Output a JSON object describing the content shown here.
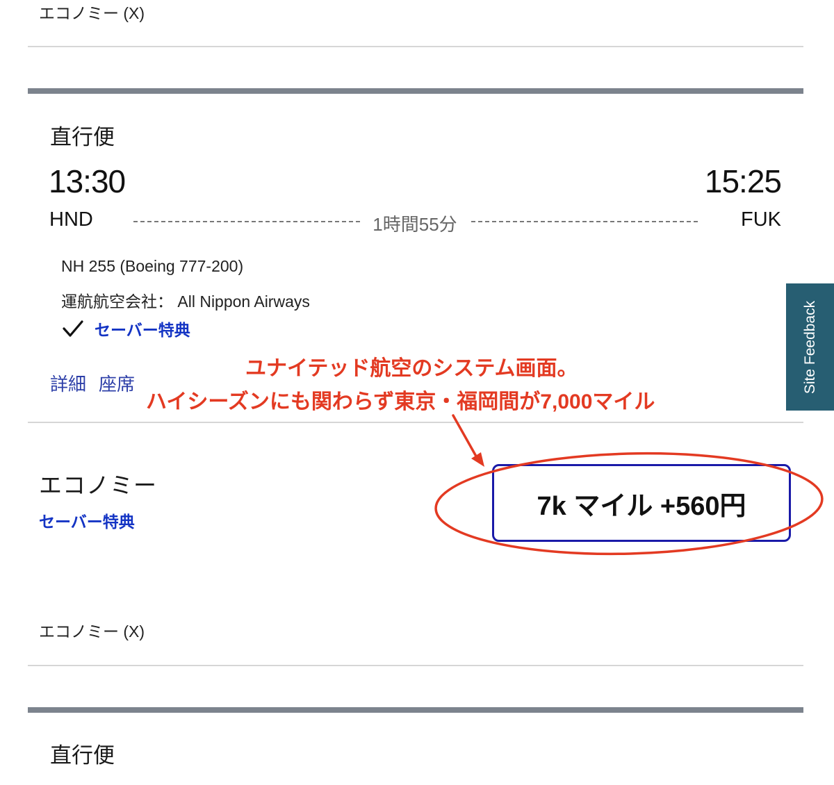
{
  "top": {
    "cabin_label": "エコノミー (X)"
  },
  "flight": {
    "nonstop_label": "直行便",
    "depart_time": "13:30",
    "arrive_time": "15:25",
    "origin": "HND",
    "destination": "FUK",
    "duration": "1時間55分",
    "flight_number": "NH 255 (Boeing 777-200)",
    "operated_by": "運航航空会社： All Nippon Airways",
    "fare_badge": "セーバー特典",
    "details_link": "詳細",
    "seats_link": "座席"
  },
  "annotation": {
    "line1": "ユナイテッド航空のシステム画面。",
    "line2": "ハイシーズンにも関わらず東京・福岡間が7,000マイル",
    "color": "#e33a22"
  },
  "fare": {
    "cabin": "エコノミー",
    "fare_type": "セーバー特典",
    "price": "7k マイル  +560円",
    "cabin_code": "エコノミー (X)"
  },
  "next_flight": {
    "nonstop_label": "直行便"
  },
  "feedback": {
    "label": "Site Feedback"
  },
  "colors": {
    "accent_blue": "#1434c4",
    "feedback_bg": "#275e72",
    "divider_thick": "#7c838d"
  }
}
